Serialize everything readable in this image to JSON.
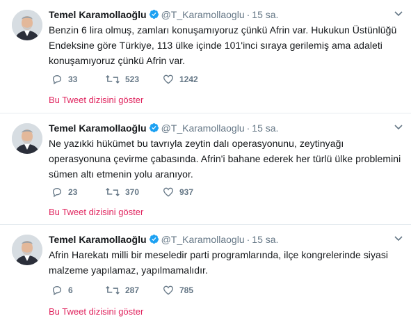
{
  "tweets": [
    {
      "name": "Temel Karamollaoğlu",
      "handle": "@T_Karamollaoglu",
      "separator": "·",
      "time": "15 sa.",
      "lines": [
        "Benzin 6 lira olmuş, zamları konuşamıyoruz çünkü Afrin var. Hukukun Üstünlüğü",
        "Endeksine göre Türkiye, 113 ülke içinde 101'inci sıraya gerilemiş ama adaleti",
        "konuşamıyoruz çünkü Afrin var."
      ],
      "replies": "33",
      "retweets": "523",
      "likes": "1242",
      "thread_link": "Bu Tweet dizisini göster"
    },
    {
      "name": "Temel Karamollaoğlu",
      "handle": "@T_Karamollaoglu",
      "separator": "·",
      "time": "15 sa.",
      "lines": [
        "Ne yazıkki hükümet bu tavrıyla zeytin dalı operasyonunu, zeytinyağı",
        "operasyonuna çevirme çabasında.  Afrin'i bahane ederek her türlü ülke problemini",
        "sümen altı etmenin yolu aranıyor."
      ],
      "replies": "23",
      "retweets": "370",
      "likes": "937",
      "thread_link": "Bu Tweet dizisini göster"
    },
    {
      "name": "Temel Karamollaoğlu",
      "handle": "@T_Karamollaoglu",
      "separator": "·",
      "time": "15 sa.",
      "lines": [
        "Afrin Harekatı milli bir meseledir parti programlarında, ilçe kongrelerinde siyasi",
        "malzeme yapılamaz, yapılmamalıdır."
      ],
      "replies": "6",
      "retweets": "287",
      "likes": "785",
      "thread_link": "Bu Tweet dizisini göster"
    }
  ],
  "icons": {
    "verified": "verified-badge-icon",
    "caret": "chevron-down-icon",
    "reply": "reply-icon",
    "retweet": "retweet-icon",
    "like": "heart-icon"
  },
  "colors": {
    "link": "#e0245e",
    "verified": "#1da1f2",
    "muted": "#657786",
    "text": "#14171a",
    "border": "#e6ecf0"
  }
}
